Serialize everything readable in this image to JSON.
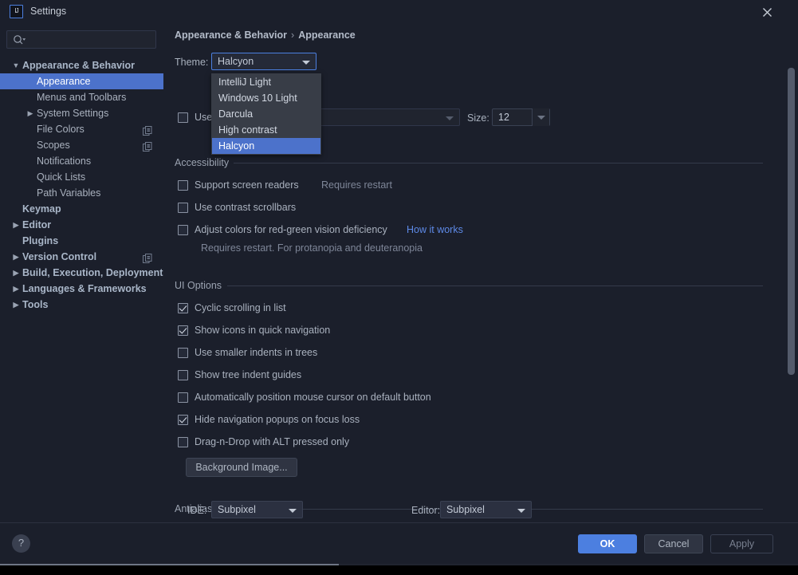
{
  "window": {
    "title": "Settings",
    "app_icon": "intellij-idea-icon",
    "close_icon": "close-icon"
  },
  "search": {
    "value": "",
    "placeholder": "",
    "icon": "search-icon"
  },
  "sidebar": {
    "items": [
      {
        "label": "Appearance & Behavior",
        "level": 0,
        "twisty": "expanded",
        "bold": true,
        "selected": false,
        "copy_icon": false
      },
      {
        "label": "Appearance",
        "level": 1,
        "twisty": "none",
        "bold": false,
        "selected": true,
        "copy_icon": false
      },
      {
        "label": "Menus and Toolbars",
        "level": 1,
        "twisty": "none",
        "bold": false,
        "selected": false,
        "copy_icon": false
      },
      {
        "label": "System Settings",
        "level": 1,
        "twisty": "collapsed",
        "bold": false,
        "selected": false,
        "copy_icon": false
      },
      {
        "label": "File Colors",
        "level": 1,
        "twisty": "none",
        "bold": false,
        "selected": false,
        "copy_icon": true
      },
      {
        "label": "Scopes",
        "level": 1,
        "twisty": "none",
        "bold": false,
        "selected": false,
        "copy_icon": true
      },
      {
        "label": "Notifications",
        "level": 1,
        "twisty": "none",
        "bold": false,
        "selected": false,
        "copy_icon": false
      },
      {
        "label": "Quick Lists",
        "level": 1,
        "twisty": "none",
        "bold": false,
        "selected": false,
        "copy_icon": false
      },
      {
        "label": "Path Variables",
        "level": 1,
        "twisty": "none",
        "bold": false,
        "selected": false,
        "copy_icon": false
      },
      {
        "label": "Keymap",
        "level": 0,
        "twisty": "none",
        "bold": true,
        "selected": false,
        "copy_icon": false
      },
      {
        "label": "Editor",
        "level": 0,
        "twisty": "collapsed",
        "bold": true,
        "selected": false,
        "copy_icon": false
      },
      {
        "label": "Plugins",
        "level": 0,
        "twisty": "none",
        "bold": true,
        "selected": false,
        "copy_icon": false
      },
      {
        "label": "Version Control",
        "level": 0,
        "twisty": "collapsed",
        "bold": true,
        "selected": false,
        "copy_icon": true
      },
      {
        "label": "Build, Execution, Deployment",
        "level": 0,
        "twisty": "collapsed",
        "bold": true,
        "selected": false,
        "copy_icon": false
      },
      {
        "label": "Languages & Frameworks",
        "level": 0,
        "twisty": "collapsed",
        "bold": true,
        "selected": false,
        "copy_icon": false
      },
      {
        "label": "Tools",
        "level": 0,
        "twisty": "collapsed",
        "bold": true,
        "selected": false,
        "copy_icon": false
      }
    ]
  },
  "breadcrumb": {
    "root": "Appearance & Behavior",
    "separator": "›",
    "leaf": "Appearance"
  },
  "theme": {
    "label": "Theme:",
    "selected": "Halcyon",
    "options": [
      {
        "label": "IntelliJ Light",
        "selected": false
      },
      {
        "label": "Windows 10 Light",
        "selected": false
      },
      {
        "label": "Darcula",
        "selected": false
      },
      {
        "label": "High contrast",
        "selected": false
      },
      {
        "label": "Halcyon",
        "selected": true
      }
    ]
  },
  "font_row": {
    "checkbox_label": "Use",
    "checked": false,
    "font_value": "",
    "size_label": "Size:",
    "size_value": "12"
  },
  "accessibility": {
    "group_title": "Accessibility",
    "items": [
      {
        "label": "Support screen readers",
        "checked": false,
        "note": "Requires restart",
        "link": ""
      },
      {
        "label": "Use contrast scrollbars",
        "checked": false,
        "note": "",
        "link": ""
      },
      {
        "label": "Adjust colors for red-green vision deficiency",
        "checked": false,
        "note": "",
        "link": "How it works"
      }
    ],
    "sub_note": "Requires restart. For protanopia and deuteranopia"
  },
  "ui_options": {
    "group_title": "UI Options",
    "items": [
      {
        "label": "Cyclic scrolling in list",
        "checked": true
      },
      {
        "label": "Show icons in quick navigation",
        "checked": true
      },
      {
        "label": "Use smaller indents in trees",
        "checked": false
      },
      {
        "label": "Show tree indent guides",
        "checked": false
      },
      {
        "label": "Automatically position mouse cursor on default button",
        "checked": false
      },
      {
        "label": "Hide navigation popups on focus loss",
        "checked": true
      },
      {
        "label": "Drag-n-Drop with ALT pressed only",
        "checked": false
      }
    ],
    "background_image_button": "Background Image..."
  },
  "antialiasing": {
    "group_title": "Antialiasing",
    "ide_label": "IDE:",
    "ide_value": "Subpixel",
    "editor_label": "Editor:",
    "editor_value": "Subpixel"
  },
  "footer": {
    "help_glyph": "?",
    "ok": "OK",
    "cancel": "Cancel",
    "apply": "Apply"
  },
  "colors": {
    "background": "#1B1F2B",
    "accent": "#4C7FE0",
    "selection": "#4C72CB",
    "popup_bg": "#383D47",
    "text": "#A9B1BE",
    "muted_text": "#7E8698",
    "link": "#5E8AE8"
  }
}
